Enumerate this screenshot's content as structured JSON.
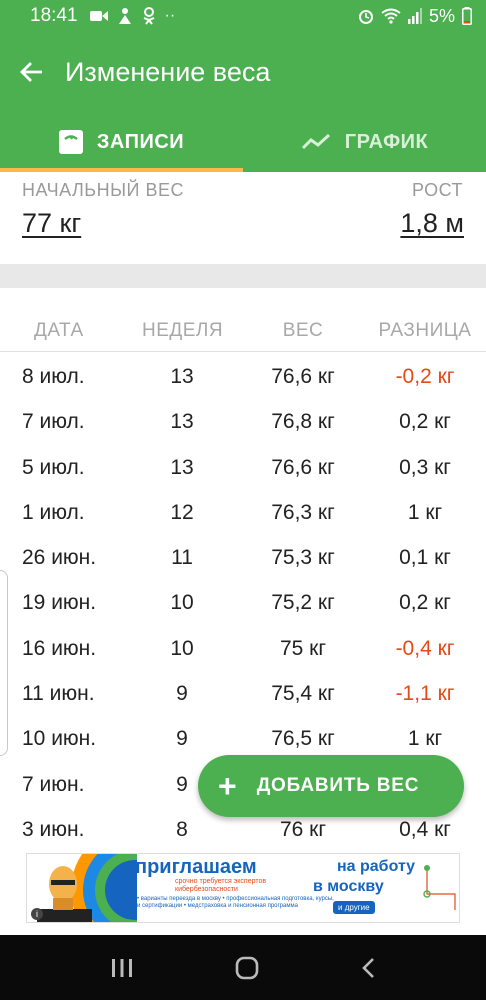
{
  "status_bar": {
    "time": "18:41",
    "battery": "5%"
  },
  "app_bar": {
    "title": "Изменение веса"
  },
  "tabs": [
    {
      "label": "ЗАПИСИ",
      "icon": "scale-icon",
      "active": true
    },
    {
      "label": "ГРАФИК",
      "icon": "trend-icon",
      "active": false
    }
  ],
  "summary": {
    "start_weight_label": "НАЧАЛЬНЫЙ ВЕС",
    "start_weight_value": "77 кг",
    "height_label": "РОСТ",
    "height_value": "1,8 м"
  },
  "table": {
    "headers": {
      "date": "ДАТА",
      "week": "НЕДЕЛЯ",
      "weight": "ВЕС",
      "diff": "РАЗНИЦА"
    },
    "rows": [
      {
        "date": "8 июл.",
        "week": "13",
        "weight": "76,6 кг",
        "diff": "-0,2 кг",
        "negative": true
      },
      {
        "date": "7 июл.",
        "week": "13",
        "weight": "76,8 кг",
        "diff": "0,2 кг",
        "negative": false
      },
      {
        "date": "5 июл.",
        "week": "13",
        "weight": "76,6 кг",
        "diff": "0,3 кг",
        "negative": false
      },
      {
        "date": "1 июл.",
        "week": "12",
        "weight": "76,3 кг",
        "diff": "1 кг",
        "negative": false
      },
      {
        "date": "26 июн.",
        "week": "11",
        "weight": "75,3 кг",
        "diff": "0,1 кг",
        "negative": false
      },
      {
        "date": "19 июн.",
        "week": "10",
        "weight": "75,2 кг",
        "diff": "0,2 кг",
        "negative": false
      },
      {
        "date": "16 июн.",
        "week": "10",
        "weight": "75 кг",
        "diff": "-0,4 кг",
        "negative": true
      },
      {
        "date": "11 июн.",
        "week": "9",
        "weight": "75,4 кг",
        "diff": "-1,1 кг",
        "negative": true
      },
      {
        "date": "10 июн.",
        "week": "9",
        "weight": "76,5 кг",
        "diff": "1 кг",
        "negative": false
      },
      {
        "date": "7 июн.",
        "week": "9",
        "weight": "",
        "diff": "",
        "negative": false
      },
      {
        "date": "3 июн.",
        "week": "8",
        "weight": "76 кг",
        "diff": "0,4 кг",
        "negative": false
      }
    ]
  },
  "fab": {
    "label": "ДОБАВИТЬ ВЕС"
  },
  "ad": {
    "headline": "приглашаем",
    "headline_2": "на работу",
    "headline_3": "в москву",
    "subline": "срочно требуется экспертов кибербезопасности",
    "bullets": "• варианты переезда в москву • профессиональная подготовка, курсы, и сертификации • медстраховка и пенсионная программа",
    "button": "и другие",
    "info": "i"
  },
  "colors": {
    "primary": "#4caf50",
    "accent": "#ffb74d",
    "negative": "#e64a19"
  }
}
